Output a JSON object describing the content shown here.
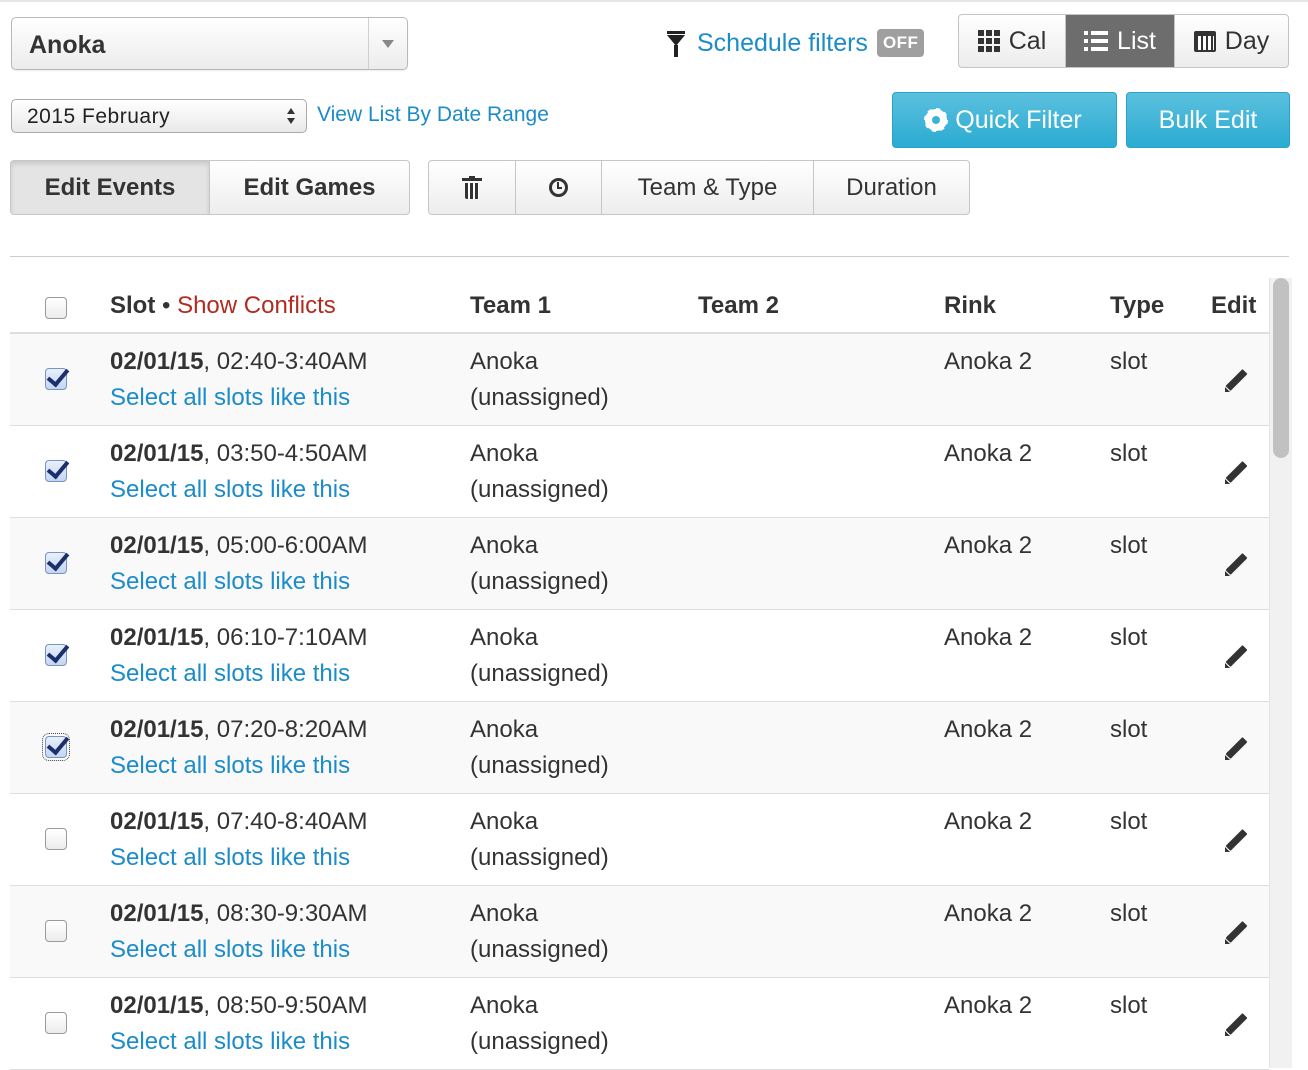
{
  "location_select": {
    "value": "Anoka"
  },
  "schedule_filters": {
    "label": "Schedule filters",
    "state": "OFF"
  },
  "view_toggle": [
    {
      "label": "Cal",
      "icon": "grid-icon",
      "active": false
    },
    {
      "label": "List",
      "icon": "list-icon",
      "active": true
    },
    {
      "label": "Day",
      "icon": "calendar-icon",
      "active": false
    }
  ],
  "month_select": {
    "value": "2015 February"
  },
  "date_range_link": "View List By Date Range",
  "buttons": {
    "quick_filter": "Quick Filter",
    "bulk_edit": "Bulk Edit"
  },
  "edit_tabs": [
    {
      "label": "Edit Events",
      "active": true
    },
    {
      "label": "Edit Games",
      "active": false
    }
  ],
  "tools": [
    {
      "label": "",
      "icon": "trash-icon"
    },
    {
      "label": "",
      "icon": "clock-icon"
    },
    {
      "label": "Team & Type",
      "icon": ""
    },
    {
      "label": "Duration",
      "icon": ""
    }
  ],
  "table": {
    "headers": {
      "slot": "Slot",
      "separator": "•",
      "show_conflicts": "Show Conflicts",
      "team1": "Team 1",
      "team2": "Team 2",
      "rink": "Rink",
      "type": "Type",
      "edit": "Edit"
    },
    "select_like_label": "Select all slots like this",
    "rows": [
      {
        "date": "02/01/15",
        "time": ", 02:40-3:40AM",
        "team1": "Anoka",
        "team1_sub": "(unassigned)",
        "team2": "",
        "rink": "Anoka 2",
        "type": "slot",
        "checked": true
      },
      {
        "date": "02/01/15",
        "time": ", 03:50-4:50AM",
        "team1": "Anoka",
        "team1_sub": "(unassigned)",
        "team2": "",
        "rink": "Anoka 2",
        "type": "slot",
        "checked": true
      },
      {
        "date": "02/01/15",
        "time": ", 05:00-6:00AM",
        "team1": "Anoka",
        "team1_sub": "(unassigned)",
        "team2": "",
        "rink": "Anoka 2",
        "type": "slot",
        "checked": true
      },
      {
        "date": "02/01/15",
        "time": ", 06:10-7:10AM",
        "team1": "Anoka",
        "team1_sub": "(unassigned)",
        "team2": "",
        "rink": "Anoka 2",
        "type": "slot",
        "checked": true
      },
      {
        "date": "02/01/15",
        "time": ", 07:20-8:20AM",
        "team1": "Anoka",
        "team1_sub": "(unassigned)",
        "team2": "",
        "rink": "Anoka 2",
        "type": "slot",
        "checked": true,
        "focused": true
      },
      {
        "date": "02/01/15",
        "time": ", 07:40-8:40AM",
        "team1": "Anoka",
        "team1_sub": "(unassigned)",
        "team2": "",
        "rink": "Anoka 2",
        "type": "slot",
        "checked": false
      },
      {
        "date": "02/01/15",
        "time": ", 08:30-9:30AM",
        "team1": "Anoka",
        "team1_sub": "(unassigned)",
        "team2": "",
        "rink": "Anoka 2",
        "type": "slot",
        "checked": false
      },
      {
        "date": "02/01/15",
        "time": ", 08:50-9:50AM",
        "team1": "Anoka",
        "team1_sub": "(unassigned)",
        "team2": "",
        "rink": "Anoka 2",
        "type": "slot",
        "checked": false
      }
    ]
  },
  "colors": {
    "link": "#1b8bc9",
    "conflicts": "#b22b20",
    "primary_button": "#3bb3d8",
    "active_toggle": "#6d6d6d"
  }
}
